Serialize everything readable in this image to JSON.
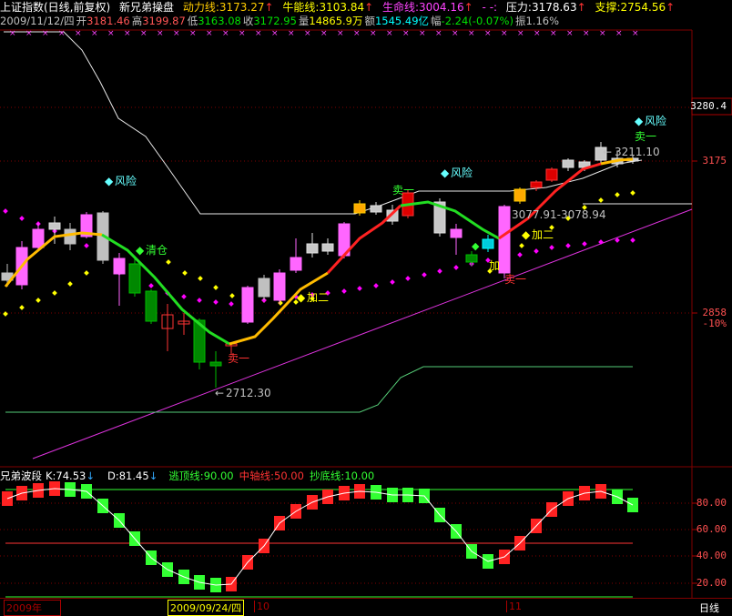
{
  "header": {
    "title": "上证指数(日线,前复权)",
    "indicator_name": "新兄弟操盘",
    "lines": [
      {
        "label": "动力线:",
        "value": "3173.27",
        "arrow": "↑",
        "color": "#ffcc00"
      },
      {
        "label": "牛能线:",
        "value": "3103.84",
        "arrow": "↑",
        "color": "#ffff00"
      },
      {
        "label": "生命线:",
        "value": "3004.16",
        "arrow": "↑",
        "color": "#ff44ff"
      },
      {
        "label": "",
        "value": "- -:",
        "arrow": "",
        "color": "#ff44ff"
      },
      {
        "label": "压力:",
        "value": "3178.63",
        "arrow": "↑",
        "color": "#ffffff"
      },
      {
        "label": "支撑:",
        "value": "2754.56",
        "arrow": "↑",
        "color": "#ffff00"
      }
    ]
  },
  "quote": {
    "date": "2009/11/12/四",
    "open_label": "开",
    "open": "3181.46",
    "high_label": "高",
    "high": "3199.87",
    "low_label": "低",
    "low": "3163.08",
    "close_label": "收",
    "close": "3172.95",
    "volume_label": "量",
    "volume": "14865.9万",
    "amount_label": "额",
    "amount": "1545.49亿",
    "change_label": "幅",
    "change": "-2.24(-0.07%)",
    "amplitude_label": "振",
    "amplitude": "1.16%"
  },
  "price_axis": {
    "top_value": "3280.4",
    "mid_value": "3175",
    "low_value": "2858",
    "low_pct": "-10%"
  },
  "annotations": {
    "risk1": "风险",
    "risk2": "风险",
    "risk3": "风险",
    "sell1": "卖一",
    "sell2": "卖一",
    "sell3": "卖一",
    "sell4": "卖一",
    "clear": "清仓",
    "add1": "加二",
    "add2": "加二",
    "add3": "加",
    "low_mark": "2712.30",
    "high_mark": "3211.10",
    "range_mark": "3077.91-3078.94"
  },
  "sub_indicator": {
    "name": "兄弟波段",
    "k_label": "K:",
    "k_value": "74.53",
    "k_arrow": "↓",
    "d_label": "D:",
    "d_value": "81.45",
    "d_arrow": "↓",
    "top_label": "逃顶线:",
    "top_value": "90.00",
    "mid_label": "中轴线:",
    "mid_value": "50.00",
    "bottom_label": "抄底线:",
    "bottom_value": "10.00",
    "axis": [
      "80.00",
      "60.00",
      "40.00",
      "20.00"
    ]
  },
  "bottom": {
    "year": "2009年",
    "cursor_date": "2009/09/24/四",
    "month10": "10",
    "month11": "11",
    "period": "日线"
  },
  "colors": {
    "up": "#ff55ff",
    "down": "#00a000",
    "bull_line": "#ff2222",
    "bear_line": "#22dd22",
    "yellow": "#ffff00",
    "magenta": "#ff00ff",
    "cyan": "#00ffff",
    "grid_red": "#800000"
  }
}
